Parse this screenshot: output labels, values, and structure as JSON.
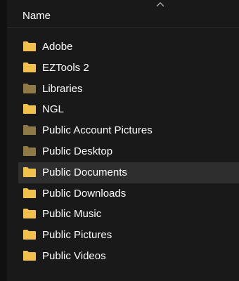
{
  "header": {
    "column_name": "Name"
  },
  "files": [
    {
      "name": "Adobe",
      "icon": "folder-icon",
      "color": "#f2c14e",
      "selected": false
    },
    {
      "name": "EZTools 2",
      "icon": "folder-icon",
      "color": "#f2c14e",
      "selected": false
    },
    {
      "name": "Libraries",
      "icon": "special-folder-icon",
      "color": "#8f7a45",
      "selected": false
    },
    {
      "name": "NGL",
      "icon": "folder-icon",
      "color": "#f2c14e",
      "selected": false
    },
    {
      "name": "Public Account Pictures",
      "icon": "special-folder-icon",
      "color": "#8f7a45",
      "selected": false
    },
    {
      "name": "Public Desktop",
      "icon": "special-folder-icon",
      "color": "#8f7a45",
      "selected": false
    },
    {
      "name": "Public Documents",
      "icon": "folder-icon",
      "color": "#f2c14e",
      "selected": true
    },
    {
      "name": "Public Downloads",
      "icon": "folder-icon",
      "color": "#f2c14e",
      "selected": false
    },
    {
      "name": "Public Music",
      "icon": "folder-icon",
      "color": "#f2c14e",
      "selected": false
    },
    {
      "name": "Public Pictures",
      "icon": "folder-icon",
      "color": "#f2c14e",
      "selected": false
    },
    {
      "name": "Public Videos",
      "icon": "folder-icon",
      "color": "#f2c14e",
      "selected": false
    }
  ]
}
